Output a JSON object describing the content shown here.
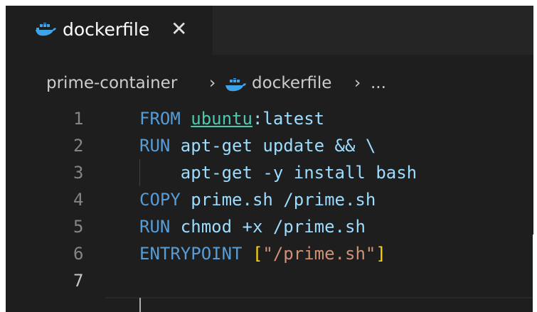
{
  "tab": {
    "label": "dockerfile",
    "close": "✕",
    "icon": "docker-whale-icon"
  },
  "breadcrumb": {
    "root": "prime-container",
    "sep": "›",
    "file": "dockerfile",
    "more": "..."
  },
  "code": {
    "lines": [
      {
        "num": "1",
        "kw": "FROM",
        "image": "ubuntu",
        "rest": ":latest"
      },
      {
        "num": "2",
        "kw": "RUN",
        "rest": " apt-get update && \\"
      },
      {
        "num": "3",
        "rest": "    apt-get -y install bash"
      },
      {
        "num": "4",
        "kw": "COPY",
        "rest": " prime.sh /prime.sh"
      },
      {
        "num": "5",
        "kw": "RUN",
        "rest": " chmod +x /prime.sh"
      },
      {
        "num": "6",
        "kw": "ENTRYPOINT",
        "open": "[",
        "str": "\"/prime.sh\"",
        "close": "]"
      },
      {
        "num": "7"
      }
    ]
  },
  "colors": {
    "background": "#1e1e1e",
    "keyword": "#569cd6",
    "text": "#9cdcfe",
    "string": "#ce9178",
    "bracket": "#ffd700",
    "docker": "#1d91e6"
  }
}
